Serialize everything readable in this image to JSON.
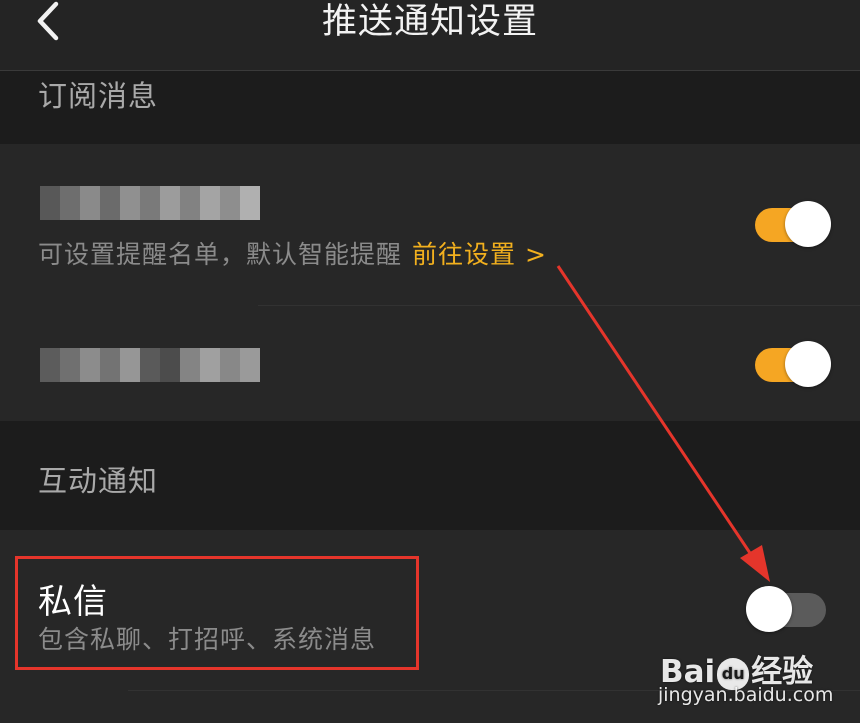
{
  "header": {
    "title": "推送通知设置",
    "back_icon": "chevron-left-icon"
  },
  "sections": {
    "subscription": {
      "title": "订阅消息"
    },
    "interaction": {
      "title": "互动通知"
    }
  },
  "rows": {
    "reminder": {
      "title": "",
      "title_obscured": true,
      "subtitle": "可设置提醒名单，默认智能提醒",
      "link": "前往设置 >",
      "toggle_on": true
    },
    "second": {
      "title": "",
      "title_obscured": true,
      "toggle_on": true
    },
    "direct_message": {
      "title": "私信",
      "subtitle": "包含私聊、打招呼、系统消息",
      "toggle_on": false
    }
  },
  "annotation": {
    "highlight_color": "#e5352b",
    "arrow_color": "#e5352b"
  },
  "watermark": {
    "logo": "Bai du 经验",
    "logo_prefix": "Bai",
    "logo_paw": "du",
    "logo_suffix": "经验",
    "url": "jingyan.baidu.com"
  },
  "colors": {
    "background": "#212121",
    "row_background": "#272727",
    "accent": "#f5a623",
    "link": "#f2b01e",
    "toggle_off": "#5b5b5b"
  }
}
